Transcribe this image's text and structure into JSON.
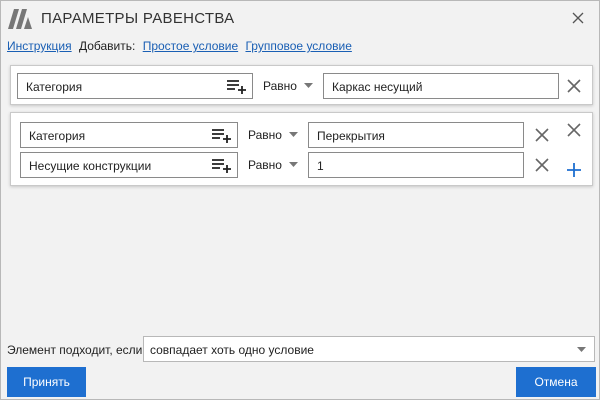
{
  "window": {
    "title": "ПАРАМЕТРЫ РАВЕНСТВА"
  },
  "links": {
    "instruction": "Инструкция",
    "add_label": "Добавить:",
    "simple_condition": "Простое условие",
    "group_condition": "Групповое условие"
  },
  "condition1": {
    "parameter": "Категория",
    "operator": "Равно",
    "value": "Каркас несущий"
  },
  "group": {
    "rows": [
      {
        "parameter": "Категория",
        "operator": "Равно",
        "value": "Перекрытия"
      },
      {
        "parameter": "Несущие конструкции",
        "operator": "Равно",
        "value": "1"
      }
    ]
  },
  "footer": {
    "match_label": "Элемент подходит, если",
    "match_value": "совпадает хоть одно условие",
    "accept": "Принять",
    "cancel": "Отмена"
  },
  "colors": {
    "accent": "#1e6fd0",
    "link": "#1a5fb4",
    "icon": "#555555"
  }
}
